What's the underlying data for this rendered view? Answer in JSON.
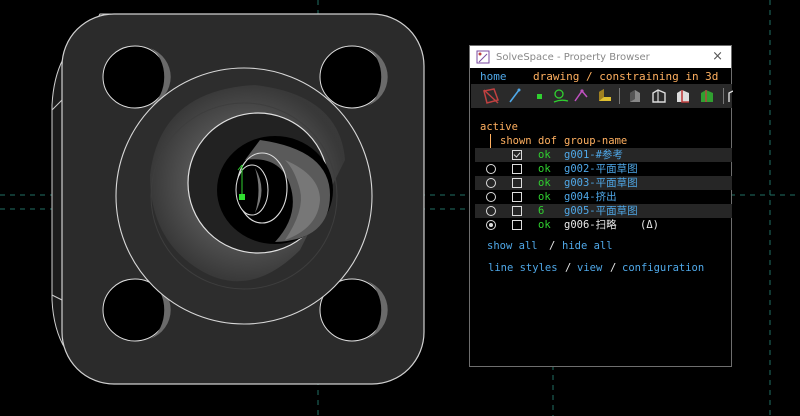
{
  "window": {
    "title": "SolveSpace - Property Browser",
    "close_symbol": "×"
  },
  "nav": {
    "home": "home",
    "mode": "drawing / constraining in 3d"
  },
  "toolbar": {
    "icons": [
      "show-workplanes-icon",
      "show-normals-icon",
      "show-points-icon",
      "show-construction-icon",
      "show-constraints-icon",
      "show-faces-icon",
      "show-shaded-icon",
      "show-hidden-lines-icon",
      "show-outline-icon",
      "show-mesh-icon",
      "show-edges-icon"
    ]
  },
  "groups": {
    "active_header": "active",
    "col_shown": "shown",
    "col_dof": "dof",
    "col_name": "group-name",
    "rows": [
      {
        "active": null,
        "shown": true,
        "dof": "ok",
        "name": "g001-#参考"
      },
      {
        "active": false,
        "shown": false,
        "dof": "ok",
        "name": "g002-平面草图"
      },
      {
        "active": false,
        "shown": false,
        "dof": "ok",
        "name": "g003-平面草图"
      },
      {
        "active": false,
        "shown": false,
        "dof": "ok",
        "name": "g004-挤出"
      },
      {
        "active": false,
        "shown": false,
        "dof": "6",
        "name": "g005-平面草图"
      },
      {
        "active": true,
        "shown": false,
        "dof": "ok",
        "name": "g006-扫略",
        "suffix": "(Δ)"
      }
    ]
  },
  "links": {
    "show_all": "show all",
    "sep1": "/",
    "hide_all": "hide all",
    "line_styles": "line styles",
    "sep2": "/",
    "view": "view",
    "sep3": "/",
    "configuration": "configuration"
  },
  "colors": {
    "accent_orange": "#ffb060",
    "link_blue": "#4fa8e8",
    "ok_green": "#30d030"
  }
}
